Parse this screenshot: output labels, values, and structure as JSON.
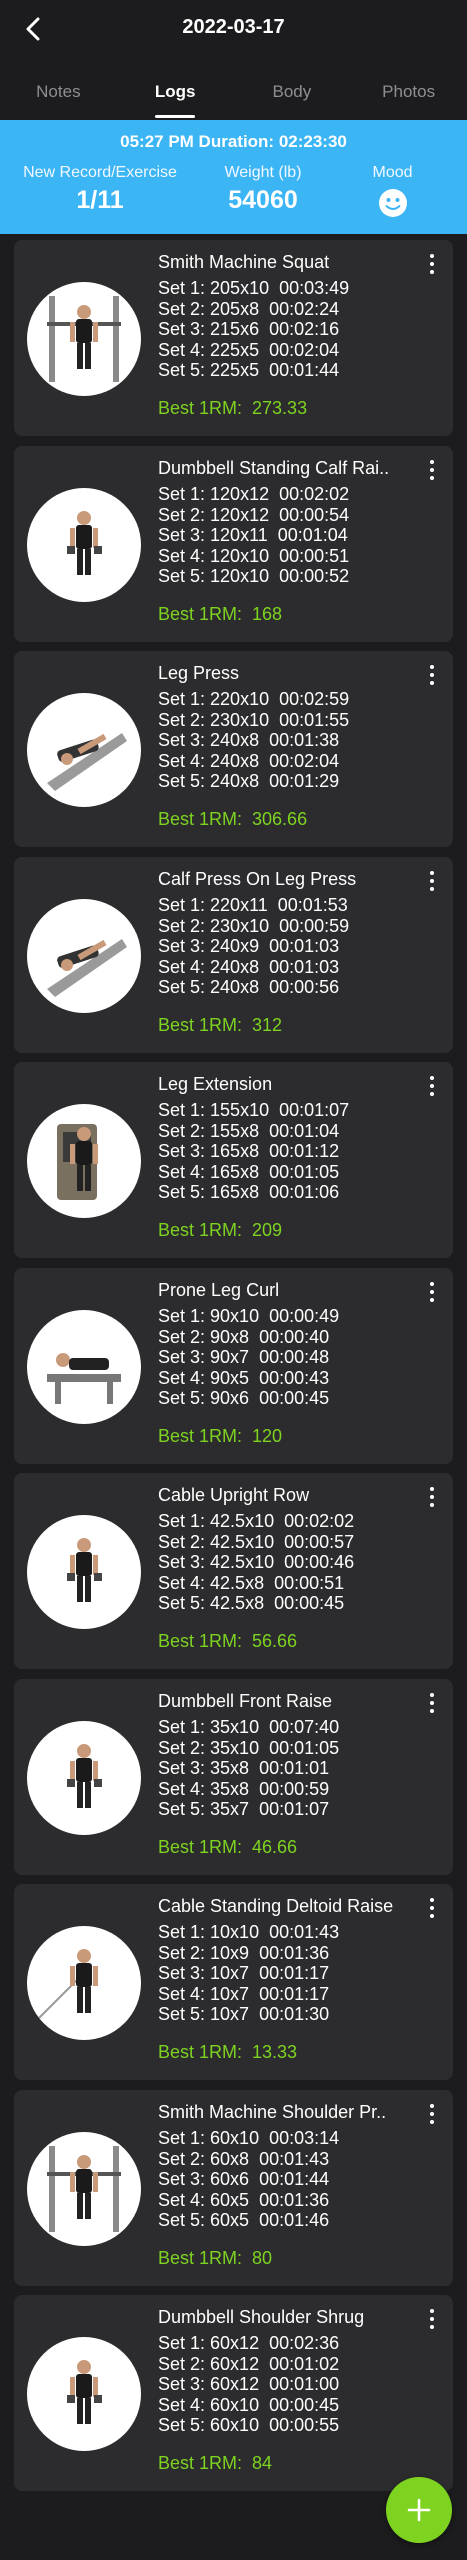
{
  "header": {
    "title": "2022-03-17"
  },
  "tabs": [
    {
      "label": "Notes"
    },
    {
      "label": "Logs"
    },
    {
      "label": "Body"
    },
    {
      "label": "Photos"
    }
  ],
  "active_tab": "Logs",
  "summary": {
    "time_duration": "05:27 PM Duration: 02:23:30",
    "record_label": "New Record/Exercise",
    "record_value": "1/11",
    "weight_label": "Weight (lb)",
    "weight_value": "54060",
    "mood_label": "Mood",
    "mood_icon": "smiley-face-icon"
  },
  "colors": {
    "accent": "#3cb5f5",
    "best": "#7ed321",
    "card": "#2c2c2e",
    "background": "#1c1c1e"
  },
  "exercises": [
    {
      "name": "Smith Machine Squat",
      "sets": [
        "Set 1: 205x10  00:03:49",
        "Set 2: 205x8  00:02:24",
        "Set 3: 215x6  00:02:16",
        "Set 4: 225x5  00:02:04",
        "Set 5: 225x5  00:01:44"
      ],
      "best": "Best 1RM:  273.33"
    },
    {
      "name": "Dumbbell Standing Calf Rai..",
      "sets": [
        "Set 1: 120x12  00:02:02",
        "Set 2: 120x12  00:00:54",
        "Set 3: 120x11  00:01:04",
        "Set 4: 120x10  00:00:51",
        "Set 5: 120x10  00:00:52"
      ],
      "best": "Best 1RM:  168"
    },
    {
      "name": "Leg Press",
      "sets": [
        "Set 1: 220x10  00:02:59",
        "Set 2: 230x10  00:01:55",
        "Set 3: 240x8  00:01:38",
        "Set 4: 240x8  00:02:04",
        "Set 5: 240x8  00:01:29"
      ],
      "best": "Best 1RM:  306.66"
    },
    {
      "name": "Calf Press On Leg Press",
      "sets": [
        "Set 1: 220x11  00:01:53",
        "Set 2: 230x10  00:00:59",
        "Set 3: 240x9  00:01:03",
        "Set 4: 240x8  00:01:03",
        "Set 5: 240x8  00:00:56"
      ],
      "best": "Best 1RM:  312"
    },
    {
      "name": "Leg Extension",
      "sets": [
        "Set 1: 155x10  00:01:07",
        "Set 2: 155x8  00:01:04",
        "Set 3: 165x8  00:01:12",
        "Set 4: 165x8  00:01:05",
        "Set 5: 165x8  00:01:06"
      ],
      "best": "Best 1RM:  209"
    },
    {
      "name": "Prone Leg Curl",
      "sets": [
        "Set 1: 90x10  00:00:49",
        "Set 2: 90x8  00:00:40",
        "Set 3: 90x7  00:00:48",
        "Set 4: 90x5  00:00:43",
        "Set 5: 90x6  00:00:45"
      ],
      "best": "Best 1RM:  120"
    },
    {
      "name": "Cable Upright Row",
      "sets": [
        "Set 1: 42.5x10  00:02:02",
        "Set 2: 42.5x10  00:00:57",
        "Set 3: 42.5x10  00:00:46",
        "Set 4: 42.5x8  00:00:51",
        "Set 5: 42.5x8  00:00:45"
      ],
      "best": "Best 1RM:  56.66"
    },
    {
      "name": "Dumbbell Front Raise",
      "sets": [
        "Set 1: 35x10  00:07:40",
        "Set 2: 35x10  00:01:05",
        "Set 3: 35x8  00:01:01",
        "Set 4: 35x8  00:00:59",
        "Set 5: 35x7  00:01:07"
      ],
      "best": "Best 1RM:  46.66"
    },
    {
      "name": "Cable Standing Deltoid Raise",
      "sets": [
        "Set 1: 10x10  00:01:43",
        "Set 2: 10x9  00:01:36",
        "Set 3: 10x7  00:01:17",
        "Set 4: 10x7  00:01:17",
        "Set 5: 10x7  00:01:30"
      ],
      "best": "Best 1RM:  13.33"
    },
    {
      "name": "Smith Machine Shoulder Pr..",
      "sets": [
        "Set 1: 60x10  00:03:14",
        "Set 2: 60x8  00:01:43",
        "Set 3: 60x6  00:01:44",
        "Set 4: 60x5  00:01:36",
        "Set 5: 60x5  00:01:46"
      ],
      "best": "Best 1RM:  80"
    },
    {
      "name": "Dumbbell Shoulder Shrug",
      "sets": [
        "Set 1: 60x12  00:02:36",
        "Set 2: 60x12  00:01:02",
        "Set 3: 60x12  00:01:00",
        "Set 4: 60x10  00:00:45",
        "Set 5: 60x10  00:00:55"
      ],
      "best": "Best 1RM:  84"
    }
  ],
  "fab_icon": "plus-icon"
}
